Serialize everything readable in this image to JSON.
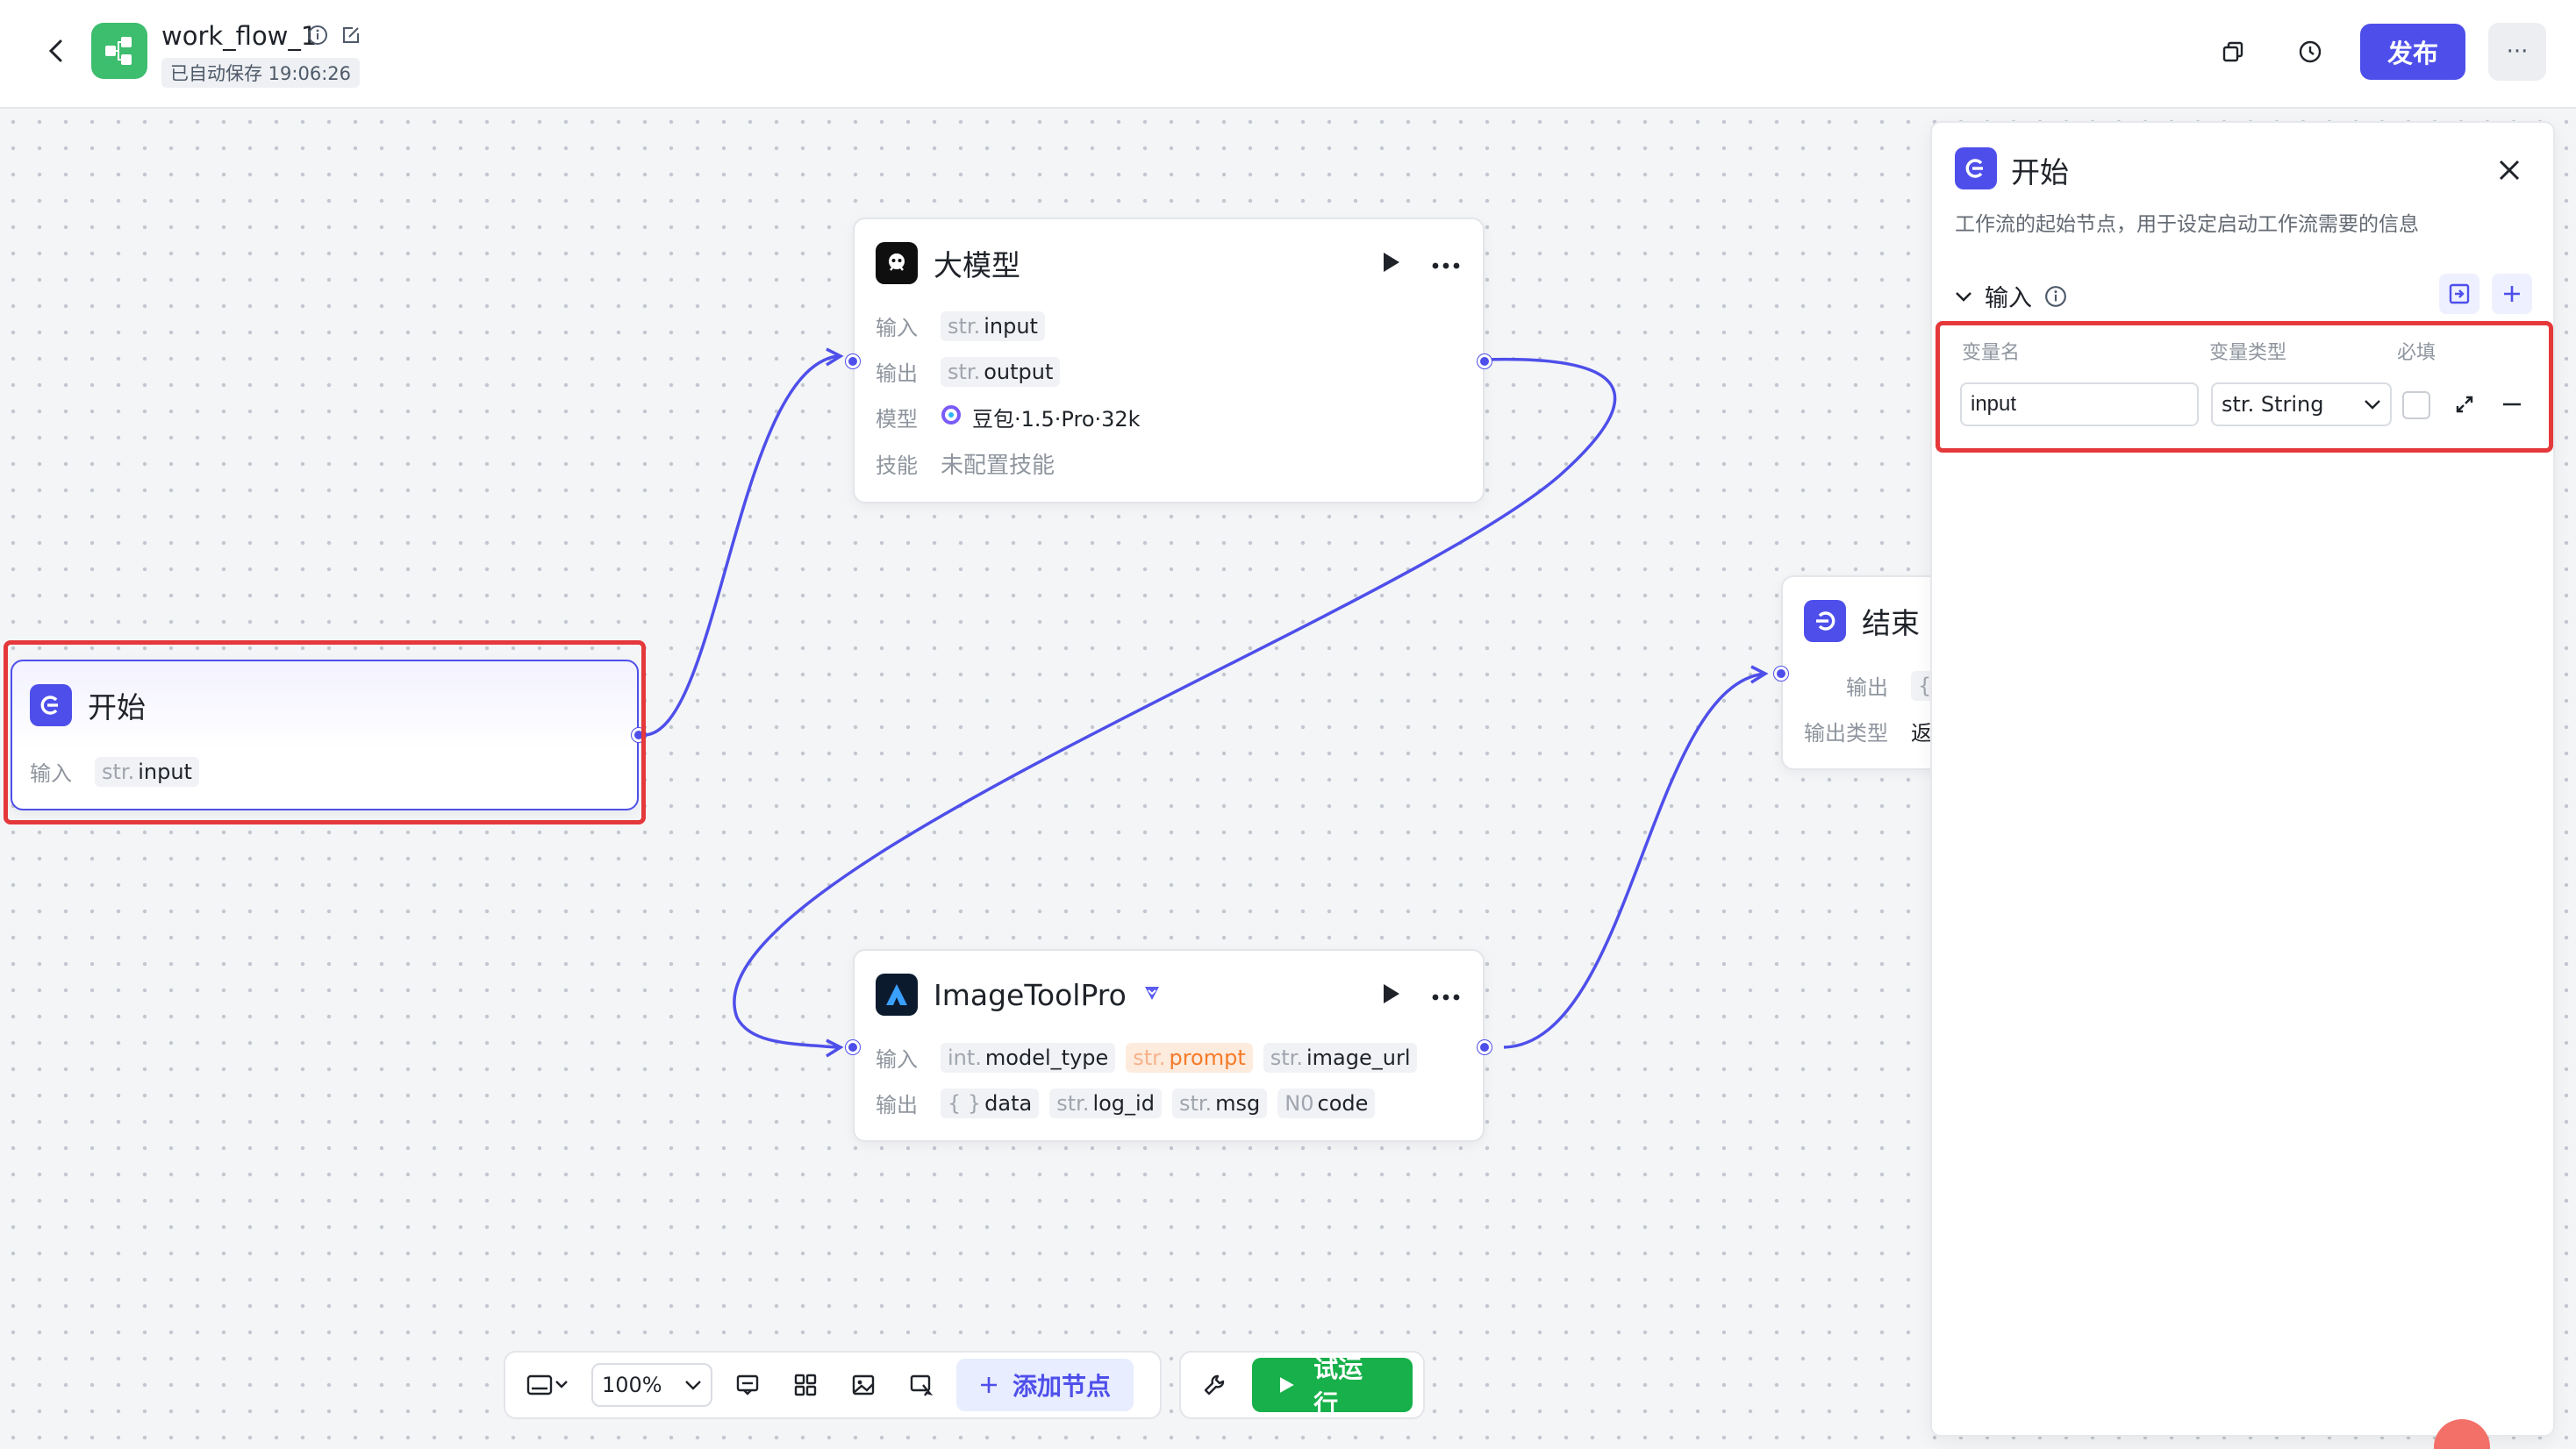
{
  "header": {
    "workflow_name": "work_flow_1",
    "save_status": "已自动保存 19:06:26",
    "publish_label": "发布",
    "more_label": "···"
  },
  "nodes": {
    "llm": {
      "title": "大模型",
      "input_label": "输入",
      "input_type": "str.",
      "input_name": "input",
      "output_label": "输出",
      "output_type": "str.",
      "output_name": "output",
      "model_label": "模型",
      "model_value": "豆包·1.5·Pro·32k",
      "skill_label": "技能",
      "skill_value": "未配置技能"
    },
    "start": {
      "title": "开始",
      "input_label": "输入",
      "input_type": "str.",
      "input_name": "input"
    },
    "image_tool": {
      "title": "ImageToolPro",
      "input_label": "输入",
      "inputs": [
        {
          "type": "int.",
          "name": "model_type"
        },
        {
          "type": "str.",
          "name": "prompt"
        },
        {
          "type": "str.",
          "name": "image_url"
        }
      ],
      "output_label": "输出",
      "outputs": [
        {
          "type": "{ }",
          "name": "data"
        },
        {
          "type": "str.",
          "name": "log_id"
        },
        {
          "type": "str.",
          "name": "msg"
        },
        {
          "type": "N0",
          "name": "code"
        }
      ]
    },
    "end": {
      "title": "结束",
      "output_label": "输出",
      "output_type": "{ }",
      "output_type_label": "输出类型",
      "output_type_value": "返"
    }
  },
  "panel": {
    "title": "开始",
    "description": "工作流的起始节点，用于设定启动工作流需要的信息",
    "section_title": "输入",
    "col_name": "变量名",
    "col_type": "变量类型",
    "col_required": "必填",
    "var_name_value": "input",
    "var_type_value": "str. String"
  },
  "toolbar": {
    "zoom_value": "100%",
    "add_node_label": "添加节点",
    "run_label": "试运行"
  },
  "colors": {
    "accent": "#4e4fea",
    "run_green": "#17b04a",
    "highlight_red": "#e5383b",
    "app_icon_green": "#3dbd6e"
  }
}
